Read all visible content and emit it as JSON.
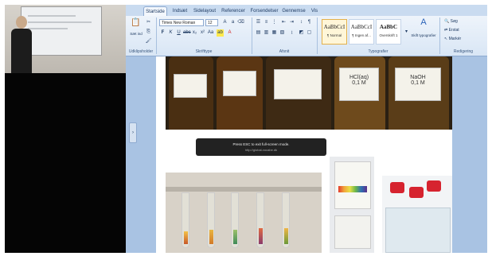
{
  "ribbon": {
    "tabs": [
      "Startside",
      "Indsæt",
      "Sidelayout",
      "Referencer",
      "Forsendelser",
      "Gennemse",
      "Vis"
    ],
    "font": {
      "name": "Times New Roman",
      "size": "12"
    },
    "groups": [
      "Udklipsholder",
      "Skrifttype",
      "Afsnit",
      "Typografier",
      "Redigering"
    ],
    "styles": [
      {
        "sample": "AaBbCcI",
        "name": "¶ Normal"
      },
      {
        "sample": "AaBbCcI",
        "name": "¶ Ingen af..."
      },
      {
        "sample": "AaBbC",
        "name": "Overskrift 1"
      }
    ],
    "change_styles": "Skift typografier",
    "editing": [
      "Søg",
      "Erstat",
      "Markér"
    ],
    "paste": "Sæt ind"
  },
  "document": {
    "labels": [
      {
        "title": "",
        "text": ""
      },
      {
        "title": "",
        "text": ""
      },
      {
        "title": "",
        "text": ""
      },
      {
        "title": "",
        "text": "HCl(aq)\n0,1 M"
      },
      {
        "title": "",
        "text": "NaOH\n0,1 M"
      }
    ],
    "fullscreen_notice": {
      "main": "Press ESC to exit full-screen mode.",
      "sub": "http://global-vocabe.dk"
    }
  },
  "colors": {
    "ribbon_blue": "#b9cfe8",
    "page": "#ffffff",
    "notice_bg": "#222222"
  }
}
